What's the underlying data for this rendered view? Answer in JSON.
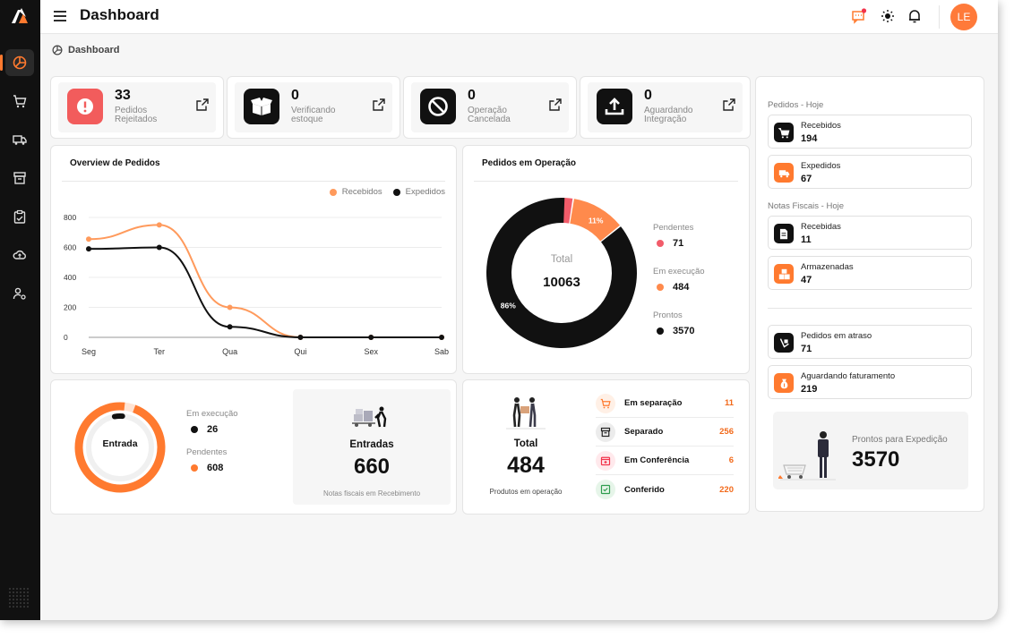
{
  "header": {
    "title": "Dashboard",
    "avatar_initials": "LE"
  },
  "breadcrumb": {
    "label": "Dashboard"
  },
  "stats": [
    {
      "value": "33",
      "label": "Pedidos Rejeitados",
      "icon": "exclamation-icon",
      "color": "#f25c5c"
    },
    {
      "value": "0",
      "label": "Verificando estoque",
      "icon": "open-box-icon",
      "color": "#111111"
    },
    {
      "value": "0",
      "label": "Operação Cancelada",
      "icon": "block-icon",
      "color": "#111111"
    },
    {
      "value": "0",
      "label": "Aguardando Integração",
      "icon": "upload-icon",
      "color": "#111111"
    }
  ],
  "overview": {
    "title": "Overview de Pedidos",
    "legend": [
      "Recebidos",
      "Expedidos"
    ]
  },
  "chart_data": [
    {
      "type": "line",
      "categories": [
        "Seg",
        "Ter",
        "Qua",
        "Qui",
        "Sex",
        "Sab"
      ],
      "ylim": [
        0,
        800
      ],
      "yticks": [
        "800",
        "600",
        "400",
        "200",
        "0"
      ],
      "series": [
        {
          "name": "Recebidos",
          "values": [
            655,
            750,
            200,
            0,
            0,
            0
          ],
          "color": "#ff9a5c"
        },
        {
          "name": "Expedidos",
          "values": [
            590,
            600,
            70,
            0,
            0,
            0
          ],
          "color": "#111111"
        }
      ]
    },
    {
      "type": "pie",
      "labels": [
        "Pendentes",
        "Em execução",
        "Prontos"
      ],
      "values": [
        71,
        484,
        3570
      ],
      "colors": [
        "#f25c6a",
        "#ff8a4c",
        "#111111"
      ],
      "slice_labels": [
        "11%",
        "86%"
      ]
    }
  ],
  "operacao": {
    "title": "Pedidos em Operação",
    "center_label": "Total",
    "center_value": "10063",
    "items": [
      {
        "label": "Pendentes",
        "value": "71",
        "color": "#f25c6a"
      },
      {
        "label": "Em execução",
        "value": "484",
        "color": "#ff8a4c"
      },
      {
        "label": "Prontos",
        "value": "3570",
        "color": "#111111"
      }
    ]
  },
  "entrada": {
    "ring_label": "Entrada",
    "items": [
      {
        "label": "Em execução",
        "value": "26",
        "color": "#111111"
      },
      {
        "label": "Pendentes",
        "value": "608",
        "color": "#ff7a2f"
      }
    ],
    "ring_fraction": 0.96,
    "inner_fraction": 0.04,
    "box_title": "Entradas",
    "box_value": "660",
    "box_caption": "Notas fiscais em Recebimento"
  },
  "produtos": {
    "total_label": "Total",
    "total_value": "484",
    "caption": "Produtos em operação",
    "rows": [
      {
        "label": "Em separação",
        "value": "11",
        "icon": "cart-icon"
      },
      {
        "label": "Separado",
        "value": "256",
        "icon": "archive-icon"
      },
      {
        "label": "Em Conferência",
        "value": "6",
        "icon": "calendar-plus-icon"
      },
      {
        "label": "Conferido",
        "value": "220",
        "icon": "check-square-icon"
      }
    ]
  },
  "right": {
    "pedidos_hoje_label": "Pedidos - Hoje",
    "notas_hoje_label": "Notas Fiscais - Hoje",
    "boxes": [
      {
        "label": "Recebidos",
        "value": "194",
        "icon": "cart-icon",
        "color": "#111111"
      },
      {
        "label": "Expedidos",
        "value": "67",
        "icon": "truck-icon",
        "color": "#ff7a2f"
      },
      {
        "label": "Recebidas",
        "value": "11",
        "icon": "document-icon",
        "color": "#111111"
      },
      {
        "label": "Armazenadas",
        "value": "47",
        "icon": "boxes-icon",
        "color": "#ff7a2f"
      },
      {
        "label": "Pedidos em atraso",
        "value": "71",
        "icon": "late-delivery-icon",
        "color": "#111111"
      },
      {
        "label": "Aguardando faturamento",
        "value": "219",
        "icon": "money-bag-icon",
        "color": "#ff7a2f"
      }
    ],
    "prontos_label": "Prontos para Expedição",
    "prontos_value": "3570"
  }
}
